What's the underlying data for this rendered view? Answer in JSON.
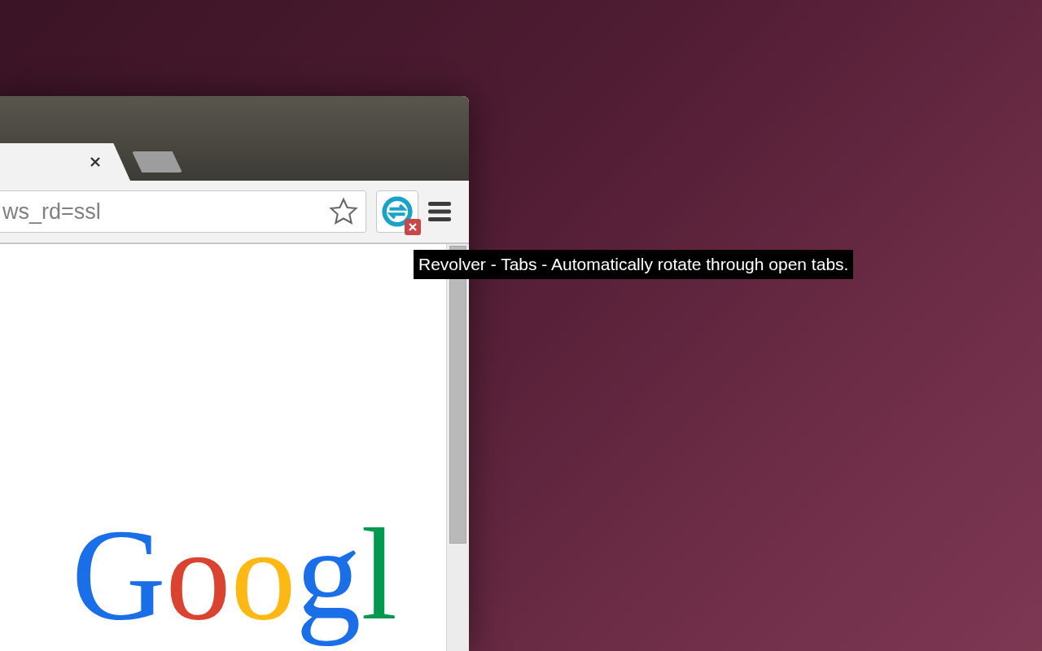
{
  "browser": {
    "tabs": [
      {
        "kind": "page",
        "selected": true
      },
      {
        "kind": "new-tab",
        "selected": false
      }
    ],
    "address_bar": {
      "value": "ws_rd=ssl",
      "bookmarked": false
    },
    "extension": {
      "error_badge": true
    },
    "page": {
      "logo": [
        {
          "text": "G",
          "color": "#1a6ee8"
        },
        {
          "text": "o",
          "color": "#d9432f"
        },
        {
          "text": "o",
          "color": "#fdb813"
        },
        {
          "text": "g",
          "color": "#1a6ee8"
        },
        {
          "text": "l",
          "color": "#00994d"
        }
      ]
    }
  },
  "tooltip": "Revolver - Tabs - Automatically rotate through open tabs."
}
